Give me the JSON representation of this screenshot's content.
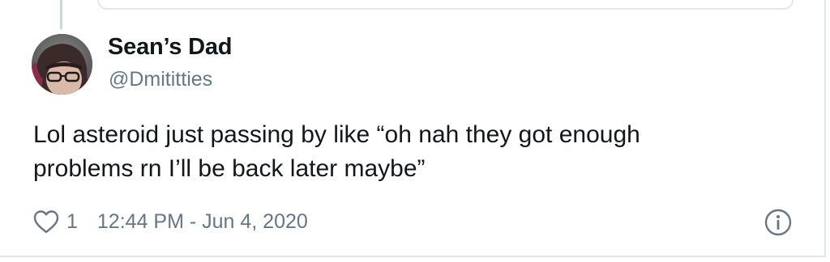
{
  "tweet": {
    "author": {
      "display_name": "Sean’s Dad",
      "handle": "@Dmititties"
    },
    "text_lines": [
      "Lol asteroid just passing by like “oh nah they got enough",
      "problems rn I’ll be back later maybe”"
    ],
    "likes": "1",
    "timestamp": "12:44 PM - Jun 4, 2020"
  },
  "icons": {
    "like": "heart-outline-icon",
    "info": "info-circle-icon"
  },
  "colors": {
    "text_primary": "#14171a",
    "text_secondary": "#657786",
    "border": "#e1e8ed",
    "thread_line": "#ccd6dd"
  }
}
